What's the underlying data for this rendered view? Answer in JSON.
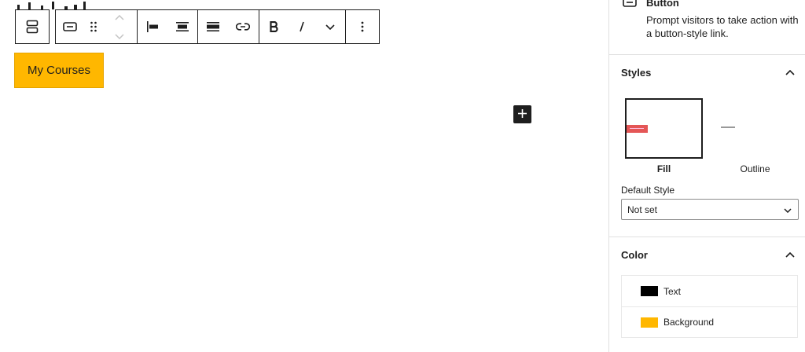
{
  "canvas": {
    "button_text": "My Courses",
    "button_bg": "#ffb700",
    "inserter_icon": "plus-icon"
  },
  "toolbar": {
    "icons": [
      "buttons-block-icon",
      "button-block-icon",
      "drag-handle-icon",
      "move-up-icon",
      "move-down-icon",
      "justify-left-icon",
      "justify-center-icon",
      "align-wide-icon",
      "link-icon",
      "bold-icon",
      "italic-icon",
      "more-rich-text-icon",
      "options-icon"
    ]
  },
  "sidebar": {
    "block_card": {
      "title": "Button",
      "description": "Prompt visitors to take action with a button-style link."
    },
    "styles": {
      "title": "Styles",
      "options": [
        {
          "label": "Fill",
          "active": true
        },
        {
          "label": "Outline",
          "active": false
        }
      ],
      "default_style_label": "Default Style",
      "default_style_value": "Not set"
    },
    "color": {
      "title": "Color",
      "items": [
        {
          "label": "Text",
          "swatch": "#000000"
        },
        {
          "label": "Background",
          "swatch": "#ffb700"
        }
      ]
    }
  }
}
